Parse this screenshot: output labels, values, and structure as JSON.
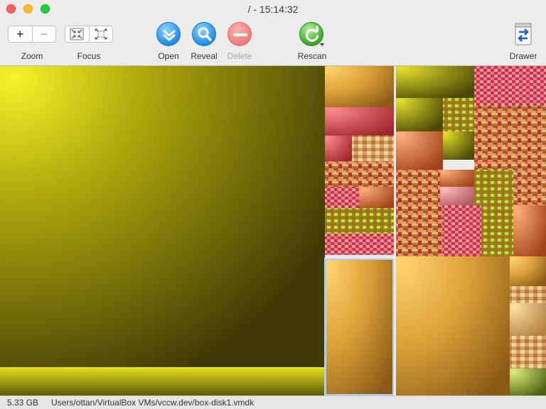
{
  "window": {
    "title": "/ - 15:14:32"
  },
  "toolbar": {
    "zoom_label": "Zoom",
    "zoom_in": "+",
    "zoom_out": "−",
    "focus_label": "Focus",
    "open_label": "Open",
    "reveal_label": "Reveal",
    "delete_label": "Delete",
    "rescan_label": "Rescan",
    "drawer_label": "Drawer"
  },
  "icons": {
    "focus_in": "focus-in-icon",
    "focus_out": "focus-out-icon",
    "open": "open-chevron-icon",
    "reveal": "magnifier-icon",
    "delete": "minus-icon",
    "rescan": "refresh-icon",
    "drawer": "swap-arrows-icon"
  },
  "colors": {
    "accent_blue": "#1e8ee8",
    "delete_red": "#ef7b7b",
    "rescan_green": "#3ea52a",
    "selection": "#a9d1f7"
  },
  "status": {
    "size": "5.33 GB",
    "path": "Users/ottan/VirtualBox VMs/vccw.dev/box-disk1.vmdk"
  }
}
